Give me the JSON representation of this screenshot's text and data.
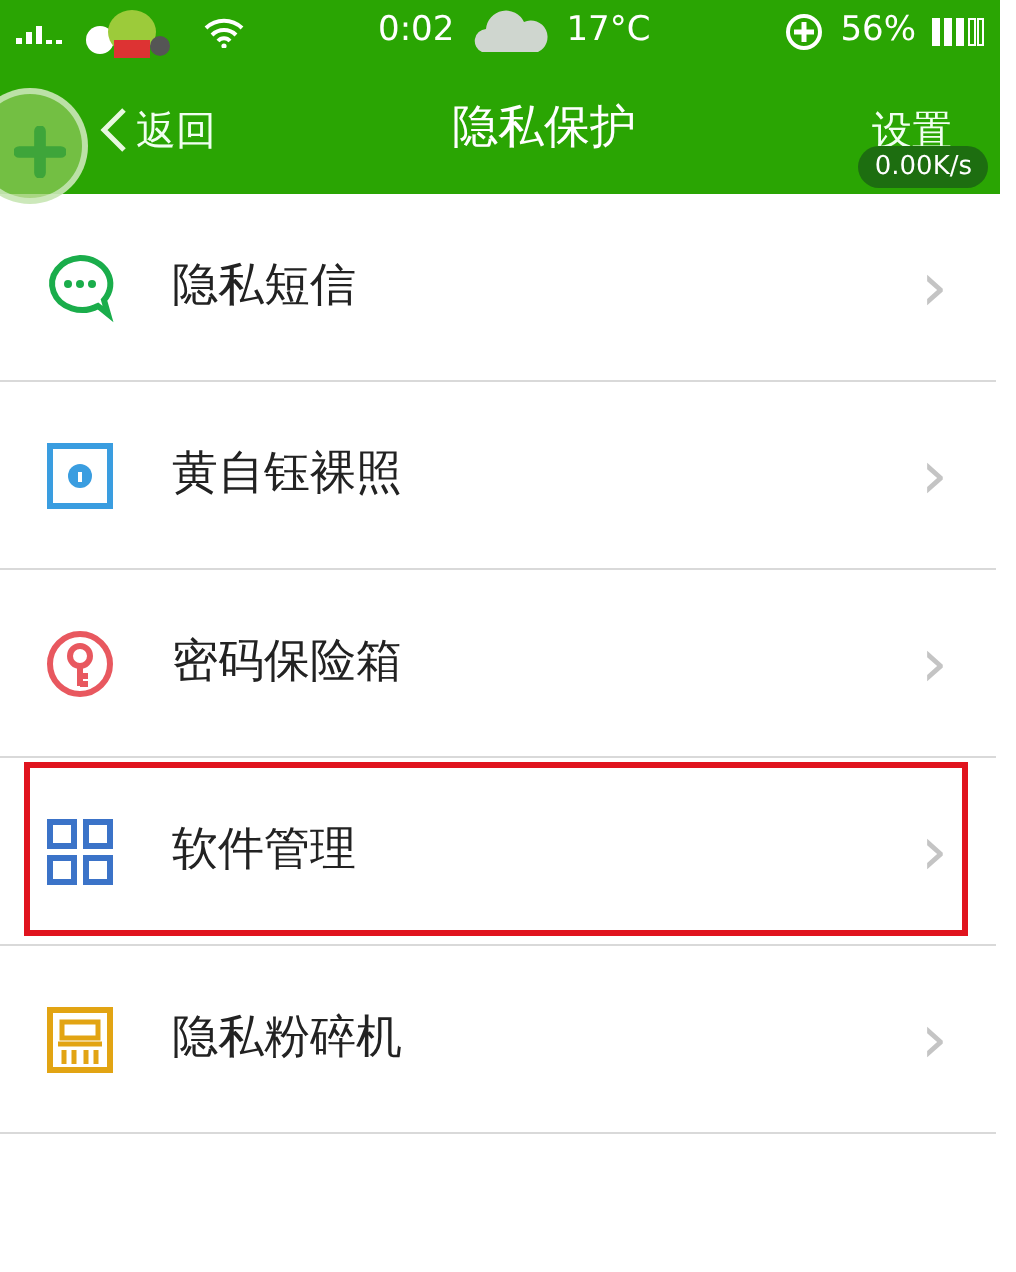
{
  "status_bar": {
    "time": "0:02",
    "temperature": "17°C",
    "battery": "56%"
  },
  "header": {
    "back": "返回",
    "title": "隐私保护",
    "settings": "设置",
    "speed": "0.00K/s"
  },
  "items": [
    {
      "label": "隐私短信",
      "kind": "message",
      "color": "#1aad4b",
      "highlighted": false
    },
    {
      "label": "黄自钰裸照",
      "kind": "photo",
      "color": "#3a9de0",
      "highlighted": false
    },
    {
      "label": "密码保险箱",
      "kind": "key",
      "color": "#e8585f",
      "highlighted": false
    },
    {
      "label": "软件管理",
      "kind": "apps",
      "color": "#3b73c8",
      "highlighted": true
    },
    {
      "label": "隐私粉碎机",
      "kind": "shredder",
      "color": "#e2a413",
      "highlighted": false
    }
  ],
  "chevron": "›"
}
